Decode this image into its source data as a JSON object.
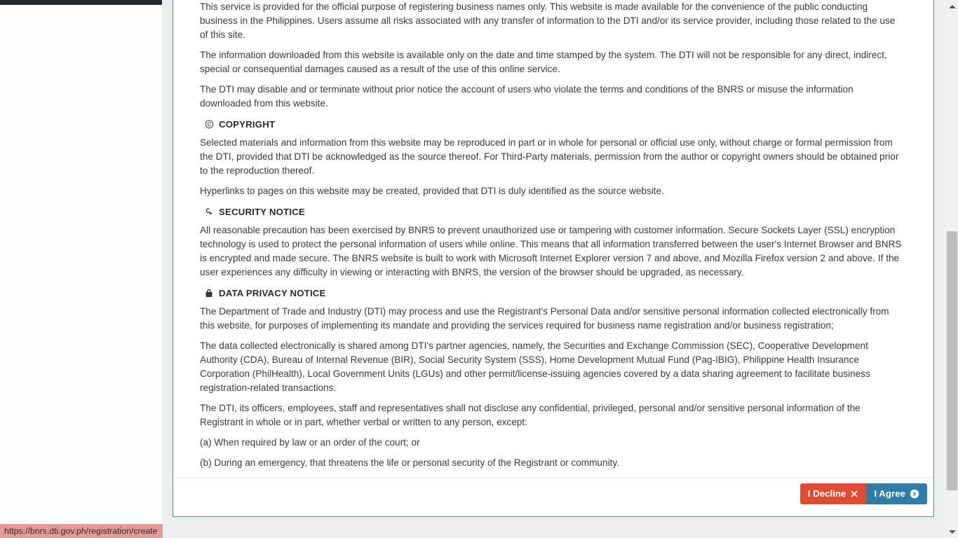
{
  "window": {
    "status_bar_url": "https://bnrs.dti.gov.ph/registration/create"
  },
  "document": {
    "intro_paragraphs": [
      "This service is provided for the official purpose of registering business names only. This website is made available for the convenience of the public conducting business in the Philippines. Users assume all risks associated with any transfer of information to the DTI and/or its service provider, including those related to the use of this site.",
      "The information downloaded from this website is available only on the date and time stamped by the system. The DTI will not be responsible for any direct, indirect, special or consequential damages caused as a result of the use of this online service.",
      "The DTI may disable and or terminate without prior notice the account of users who violate the terms and conditions of the BNRS or misuse the information downloaded from this website."
    ],
    "sections": [
      {
        "icon": "copyright-icon",
        "title": "COPYRIGHT",
        "paragraphs": [
          "Selected materials and information from this website may be reproduced in part or in whole for personal or official use only, without charge or formal permission from the DTI, provided that DTI be acknowledged as the source thereof. For Third-Party materials, permission from the author or copyright owners should be obtained prior to the reproduction thereof.",
          "Hyperlinks to pages on this website may be created, provided that DTI is duly identified as the source website."
        ]
      },
      {
        "icon": "key-icon",
        "title": "SECURITY NOTICE",
        "paragraphs": [
          "All reasonable precaution has been exercised by BNRS to prevent unauthorized use or tampering with customer information. Secure Sockets Layer (SSL) encryption technology is used to protect the personal information of users while online. This means that all information transferred between the user's Internet Browser and BNRS is encrypted and made secure. The BNRS website is built to work with Microsoft Internet Explorer version 7 and above, and Mozilla Firefox version 2 and above. If the user experiences any difficulty in viewing or interacting with BNRS, the version of the browser should be upgraded, as necessary."
        ]
      },
      {
        "icon": "lock-icon",
        "title": "DATA PRIVACY NOTICE",
        "paragraphs": [
          "The Department of Trade and Industry (DTI) may process and use the Registrant's Personal Data and/or sensitive personal information collected electronically from this website, for purposes of implementing its mandate and providing the services required for business name registration and/or business registration;",
          "The data collected electronically is shared among DTI's partner agencies, namely, the Securities and Exchange Commission (SEC), Cooperative Development Authority (CDA), Bureau of Internal Revenue (BIR), Social Security System (SSS), Home Development Mutual Fund (Pag-IBIG), Philippine Health Insurance Corporation (PhilHealth), Local Government Units (LGUs) and other permit/license-issuing agencies covered by a data sharing agreement to facilitate business registration-related transactions.",
          "The DTI, its officers, employees, staff and representatives shall not disclose any confidential, privileged, personal and/or sensitive personal information of the Registrant in whole or in part, whether verbal or written to any person, except:",
          "(a) When required by law or an order of the court; or",
          "(b) During an emergency, that threatens the life or personal security of the Registrant or community."
        ]
      }
    ]
  },
  "footer": {
    "decline_label": "I Decline",
    "agree_label": "I Agree",
    "decline_icon": "close-x-icon",
    "agree_icon": "arrow-circle-right-icon",
    "decline_color": "#e04b34",
    "agree_color": "#2f7da8"
  },
  "scrollbar": {
    "up_icon": "chevron-up-icon",
    "down_icon": "chevron-down-icon"
  }
}
